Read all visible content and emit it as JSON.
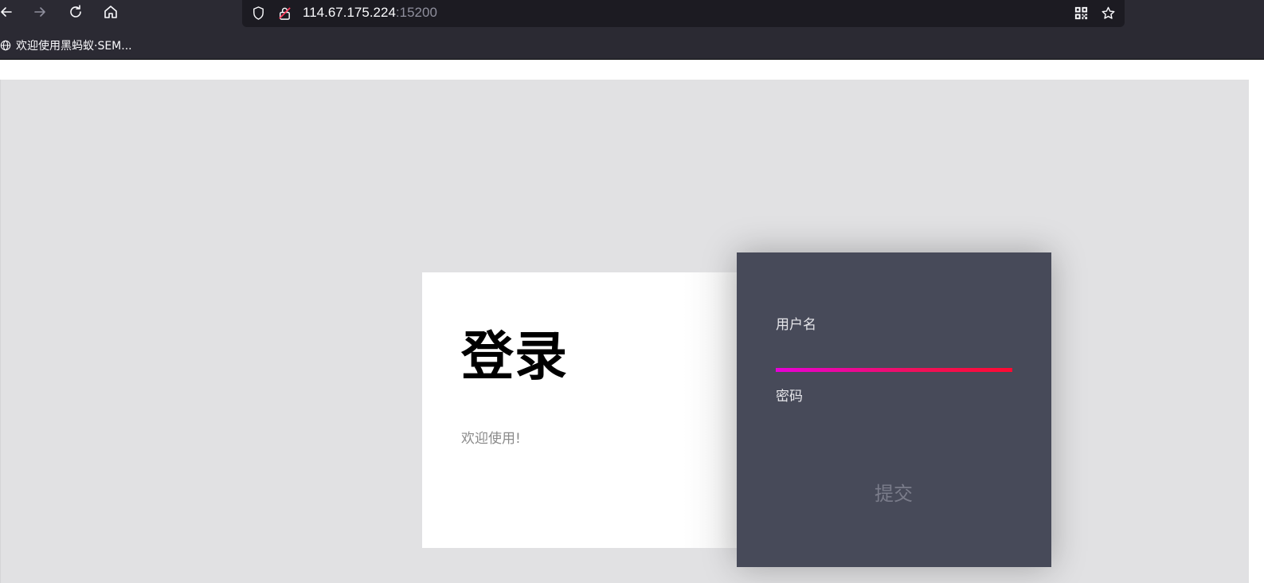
{
  "browser": {
    "url_host": "114.67.175.224",
    "url_port": ":15200",
    "bookmark_label": "欢迎使用黑蚂蚁·SEM..."
  },
  "login": {
    "title": "登录",
    "welcome": "欢迎使用!",
    "username_label": "用户名",
    "password_label": "密码",
    "submit_label": "提交"
  },
  "colors": {
    "chrome": "#2b2a33",
    "urlbar": "#1c1b22",
    "stage": "#e1e1e3",
    "form_panel": "#474a59",
    "underline_start": "#e800d8",
    "underline_end": "#ff0a32"
  },
  "icons": [
    "back-arrow-icon",
    "forward-arrow-icon",
    "reload-icon",
    "home-icon",
    "shield-icon",
    "insecure-lock-icon",
    "qr-code-icon",
    "star-icon",
    "globe-icon"
  ]
}
